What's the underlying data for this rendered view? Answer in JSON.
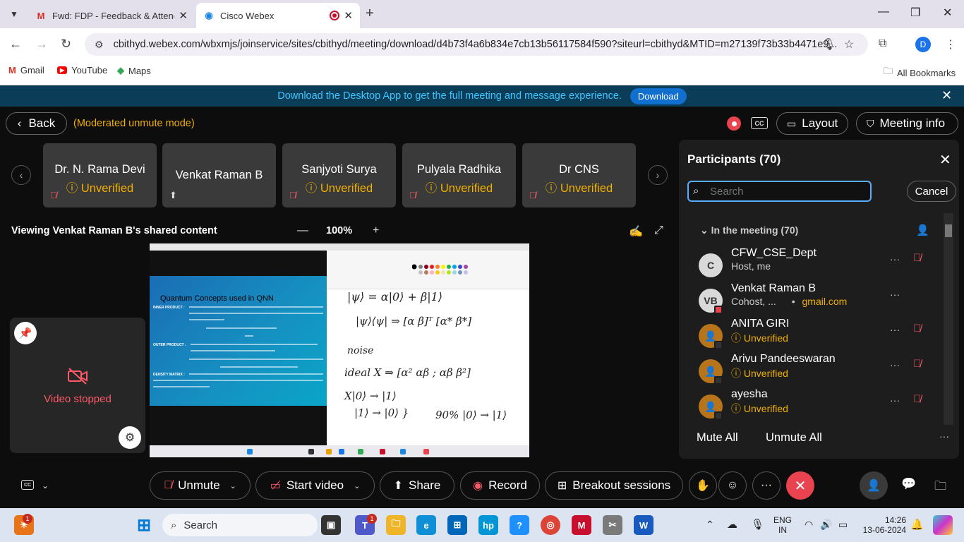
{
  "browser": {
    "tabs": [
      {
        "title": "Fwd: FDP - Feedback & Attenda",
        "icon": "gmail-icon"
      },
      {
        "title": "Cisco Webex",
        "icon": "webex-icon"
      }
    ],
    "url": "cbithyd.webex.com/wbxmjs/joinservice/sites/cbithyd/meeting/download/d4b73f4a6b834e7cb13b56117584f590?siteurl=cbithyd&MTID=m27139f73b33b4471e9...",
    "profile_initial": "D",
    "bookmarks": [
      "Gmail",
      "YouTube",
      "Maps"
    ],
    "all_bookmarks": "All Bookmarks"
  },
  "banner": {
    "text": "Download the Desktop App to get the full meeting and message experience.",
    "button": "Download"
  },
  "header": {
    "back": "Back",
    "mode": "(Moderated unmute mode)",
    "cc": "CC",
    "layout": "Layout",
    "meeting_info": "Meeting info"
  },
  "thumbnails": [
    {
      "name": "Dr. N. Rama Devi",
      "status": "Unverified"
    },
    {
      "name": "Venkat Raman B",
      "status": ""
    },
    {
      "name": "Sanjyoti Surya",
      "status": "Unverified"
    },
    {
      "name": "Pulyala Radhika",
      "status": "Unverified"
    },
    {
      "name": "Dr CNS",
      "status": "Unverified"
    }
  ],
  "share": {
    "title": "Viewing Venkat Raman B's shared content",
    "zoom": "100%",
    "slide_title": "Quantum Concepts used in QNN",
    "slide_labels": [
      "INNER PRODUCT :",
      "OUTER PRODUCT :",
      "DENSITY MATRIX :"
    ],
    "handwriting": [
      "|ψ⟩ = α|0⟩ + β|1⟩",
      "|ψ⟩⟨ψ| ⇒ [α β]ᵀ [α* β*]",
      "noise",
      "ideal X  ⇒ [α²  αβ ; αβ  β²]",
      "X|0⟩ → |1⟩",
      "|1⟩ → |0⟩ }",
      "90% |0⟩ → |1⟩"
    ]
  },
  "self_view": {
    "status": "Video stopped"
  },
  "participants": {
    "title": "Participants (70)",
    "search_placeholder": "Search",
    "cancel": "Cancel",
    "section": "In the meeting (70)",
    "list": [
      {
        "initials": "C",
        "name": "CFW_CSE_Dept",
        "sub": "Host, me",
        "sub2": "",
        "warn": false,
        "avatar_color": "#d9d9d9"
      },
      {
        "initials": "VB",
        "name": "Venkat Raman B",
        "sub": "Cohost, ...",
        "sub2": "gmail.com",
        "warn": false,
        "avatar_color": "#d9d9d9"
      },
      {
        "initials": "",
        "name": "ANITA GIRI",
        "sub": "Unverified",
        "sub2": "",
        "warn": true,
        "avatar_color": "#b8741a"
      },
      {
        "initials": "",
        "name": "Arivu Pandeeswaran",
        "sub": "Unverified",
        "sub2": "",
        "warn": true,
        "avatar_color": "#b8741a"
      },
      {
        "initials": "",
        "name": "ayesha",
        "sub": "Unverified",
        "sub2": "",
        "warn": true,
        "avatar_color": "#b8741a"
      }
    ],
    "mute_all": "Mute All",
    "unmute_all": "Unmute All"
  },
  "controls": {
    "unmute": "Unmute",
    "start_video": "Start video",
    "share": "Share",
    "record": "Record",
    "breakout": "Breakout sessions"
  },
  "taskbar": {
    "search": "Search",
    "lang_top": "ENG",
    "lang_bottom": "IN",
    "time": "14:26",
    "date": "13-06-2024",
    "notification_count": "1",
    "teams_count": "1"
  },
  "colors": {
    "accent_blue": "#1170cf",
    "warning": "#f0b000",
    "danger": "#e8434e",
    "panel_bg": "#1d1d1d"
  }
}
